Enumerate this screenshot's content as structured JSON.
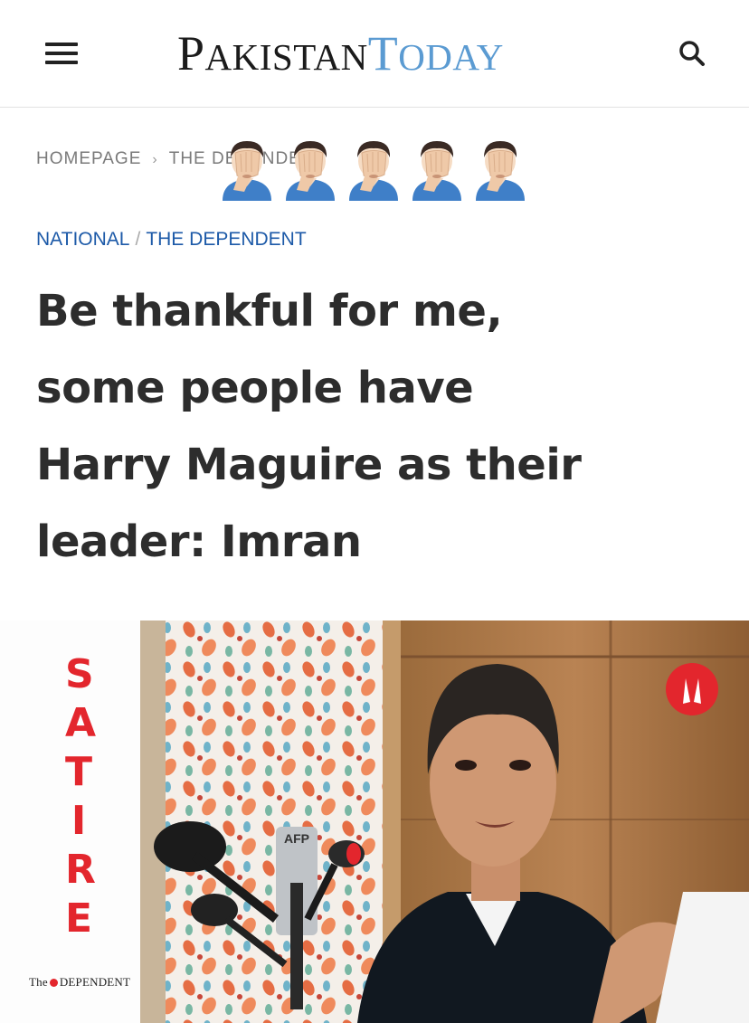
{
  "header": {
    "logo_word1_cap": "P",
    "logo_word1_rest": "AKISTAN",
    "logo_word2_cap": "T",
    "logo_word2_rest": "ODAY",
    "menu_icon": "hamburger-menu-icon",
    "search_icon": "search-icon"
  },
  "breadcrumb": {
    "home": "HOMEPAGE",
    "separator": "›",
    "current": "THE DEPENDENT"
  },
  "emoji_overlay": {
    "icon": "facepalm-emoji",
    "count": 5
  },
  "categories": {
    "primary": "NATIONAL",
    "divider": "/",
    "secondary": "THE DEPENDENT"
  },
  "article": {
    "headline_lines": [
      "Be thankful for me,",
      "some people have",
      "Harry Maguire as their",
      "leader: Imran"
    ]
  },
  "image": {
    "satire_letters": [
      "S",
      "A",
      "T",
      "I",
      "R",
      "E"
    ],
    "brand_the": "The",
    "brand_name": "DEPENDENT",
    "mic_label": "AFP",
    "badge_icon": "praying-hands-icon"
  },
  "colors": {
    "logo_today": "#5b9bd2",
    "category_link": "#1d5aa8",
    "satire_red": "#e3262d",
    "headline": "#2d2d2d"
  }
}
